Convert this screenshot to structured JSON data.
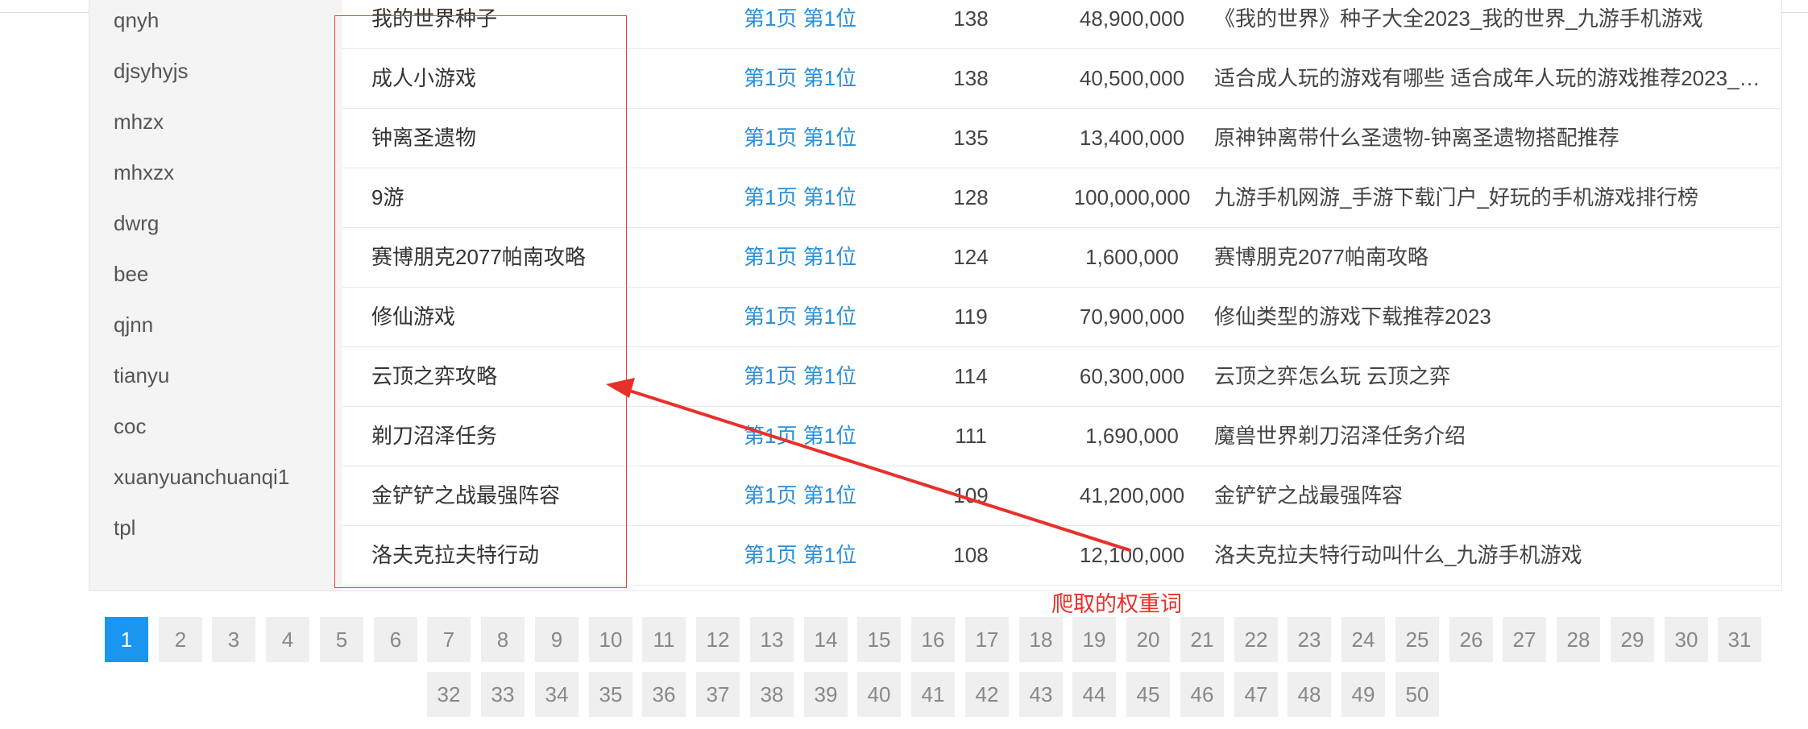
{
  "sidebar": {
    "items": [
      "qnyh",
      "djsyhyjs",
      "mhzx",
      "mhxzx",
      "dwrg",
      "bee",
      "qjnn",
      "tianyu",
      "coc",
      "xuanyuanchuanqi1",
      "tpl"
    ]
  },
  "table": {
    "rows": [
      {
        "keyword": "我的世界种子",
        "rank": "第1页 第1位",
        "index": "138",
        "volume": "48,900,000",
        "title": "《我的世界》种子大全2023_我的世界_九游手机游戏"
      },
      {
        "keyword": "成人小游戏",
        "rank": "第1页 第1位",
        "index": "138",
        "volume": "40,500,000",
        "title": "适合成人玩的游戏有哪些 适合成年人玩的游戏推荐2023_九游..."
      },
      {
        "keyword": "钟离圣遗物",
        "rank": "第1页 第1位",
        "index": "135",
        "volume": "13,400,000",
        "title": "原神钟离带什么圣遗物-钟离圣遗物搭配推荐"
      },
      {
        "keyword": "9游",
        "rank": "第1页 第1位",
        "index": "128",
        "volume": "100,000,000",
        "title": "九游手机网游_手游下载门户_好玩的手机游戏排行榜"
      },
      {
        "keyword": "赛博朋克2077帕南攻略",
        "rank": "第1页 第1位",
        "index": "124",
        "volume": "1,600,000",
        "title": "赛博朋克2077帕南攻略"
      },
      {
        "keyword": "修仙游戏",
        "rank": "第1页 第1位",
        "index": "119",
        "volume": "70,900,000",
        "title": "修仙类型的游戏下载推荐2023"
      },
      {
        "keyword": "云顶之弈攻略",
        "rank": "第1页 第1位",
        "index": "114",
        "volume": "60,300,000",
        "title": "云顶之弈怎么玩 云顶之弈"
      },
      {
        "keyword": "剃刀沼泽任务",
        "rank": "第1页 第1位",
        "index": "111",
        "volume": "1,690,000",
        "title": "魔兽世界剃刀沼泽任务介绍"
      },
      {
        "keyword": "金铲铲之战最强阵容",
        "rank": "第1页 第1位",
        "index": "109",
        "volume": "41,200,000",
        "title": "金铲铲之战最强阵容"
      },
      {
        "keyword": "洛夫克拉夫特行动",
        "rank": "第1页 第1位",
        "index": "108",
        "volume": "12,100,000",
        "title": "洛夫克拉夫特行动叫什么_九游手机游戏"
      }
    ]
  },
  "annotation": {
    "label": "爬取的权重词",
    "color": "#e8302a"
  },
  "pagination": {
    "current": "1",
    "pages": [
      "1",
      "2",
      "3",
      "4",
      "5",
      "6",
      "7",
      "8",
      "9",
      "10",
      "11",
      "12",
      "13",
      "14",
      "15",
      "16",
      "17",
      "18",
      "19",
      "20",
      "21",
      "22",
      "23",
      "24",
      "25",
      "26",
      "27",
      "28",
      "29",
      "30",
      "31",
      "32",
      "33",
      "34",
      "35",
      "36",
      "37",
      "38",
      "39",
      "40",
      "41",
      "42",
      "43",
      "44",
      "45",
      "46",
      "47",
      "48",
      "49",
      "50"
    ],
    "accent": "#1a96f0"
  },
  "colors": {
    "rank_link": "#2a8fd8",
    "annotation": "#e8302a"
  }
}
